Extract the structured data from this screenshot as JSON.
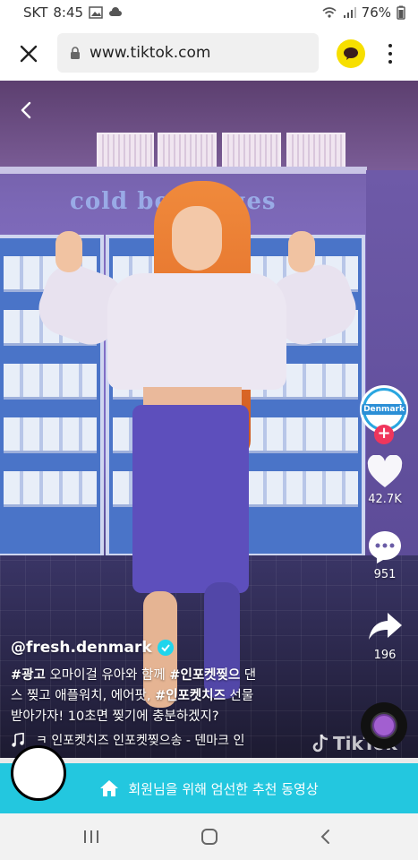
{
  "status_bar": {
    "carrier": "SKT",
    "time": "8:45",
    "battery": "76%",
    "icons": [
      "image-icon",
      "cloud-icon",
      "wifi-icon",
      "signal-icon",
      "battery-icon"
    ]
  },
  "browser": {
    "url": "www.tiktok.com",
    "icons": [
      "close-icon",
      "lock-icon",
      "kakao-chat-icon",
      "more-vert-icon"
    ]
  },
  "video": {
    "wall_sign": "cold beverages",
    "rail": {
      "avatar_label": "Denmark",
      "likes": "42.7K",
      "comments": "951",
      "shares": "196"
    },
    "username": "@fresh.denmark",
    "caption": {
      "line1_tag1": "#광고",
      "line1_text1": " 오마이걸 유아와 함께 ",
      "line1_tag2": "#인포켓찢으",
      "line1_text2": " 댄",
      "line2_text1": "스 찢고 애플워치, 에어팟, ",
      "line2_tag": "#인포켓치즈",
      "line2_text2": " 선물",
      "line3": "받아가자! 10초면 찢기에 충분하겠지?"
    },
    "music": "ㅋ 인포켓치즈      인포켓찢으송 - 덴마크 인",
    "watermark": "TikTok"
  },
  "banner": {
    "text": "회원님을 위해 엄선한 추천 동영상"
  },
  "navbar": {
    "icons": [
      "recent-apps-icon",
      "home-icon",
      "back-icon"
    ]
  },
  "colors": {
    "accent": "#23c7df",
    "follow": "#f0365c",
    "kakao": "#f7df00"
  }
}
